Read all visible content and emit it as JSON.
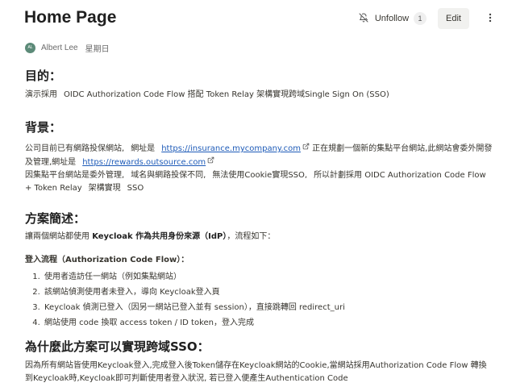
{
  "header": {
    "title": "Home Page",
    "unfollow_label": "Unfollow",
    "follow_count": "1",
    "edit_label": "Edit",
    "author_initials": "AL",
    "author_name": "Albert Lee",
    "author_date": "星期日"
  },
  "icons": {
    "unfollow": "bell-slash-icon",
    "more": "more-vertical-icon",
    "external": "external-link-icon"
  },
  "colors": {
    "link": "#1e5bb8",
    "edit_button_bg": "#f1f1ef",
    "avatar_bg": "#5c8a78"
  },
  "sections": {
    "purpose": {
      "heading": "目的：",
      "text_a": "演示採用",
      "text_b": "OIDC Authorization Code Flow 搭配 Token Relay 架構實現跨域Single Sign On (SSO)"
    },
    "background": {
      "heading": "背景：",
      "l1a": "公司目前已有網路投保網站,",
      "l1b": "網址是",
      "link1": "https://insurance.mycompany.com",
      "l1c": "正在規劃一個新的集點平台網站,此網站會委外開發及管理,網址是",
      "link2": "https://rewards.outsource.com",
      "l2a": "因集點平台網站是委外管理,",
      "l2b": "域名與網路投保不同,",
      "l2c": "無法使用Cookie實現SSO,",
      "l2d": "所以計劃採用 OIDC Authorization Code Flow + Token Relay",
      "l2e": "架構實現",
      "l2f": "SSO"
    },
    "plan": {
      "heading": "方案簡述：",
      "intro_a": "讓兩個網站都使用",
      "intro_bold": "Keycloak 作為共用身份來源（IdP）",
      "intro_b": "，流程如下：",
      "flow_title": "登入流程（Authorization Code Flow）：",
      "steps": [
        "使用者造訪任一網站（例如集點網站）",
        "該網站偵測使用者未登入，導向 Keycloak登入頁",
        "Keycloak 偵測已登入（因另一網站已登入並有 session），直接跳轉回 redirect_uri",
        "網站使用 code 換取 access token / ID token，登入完成"
      ]
    },
    "why": {
      "heading": "為什麼此方案可以實現跨域SSO：",
      "text": "因為所有網站皆使用Keycloak登入,完成登入後Token儲存在Keycloak網站的Cookie,當網站採用Authorization Code Flow 轉換到Keycloak時,Keycloak即可判斷使用者登入狀況, 若已登入便產生Authentication Code"
    }
  }
}
